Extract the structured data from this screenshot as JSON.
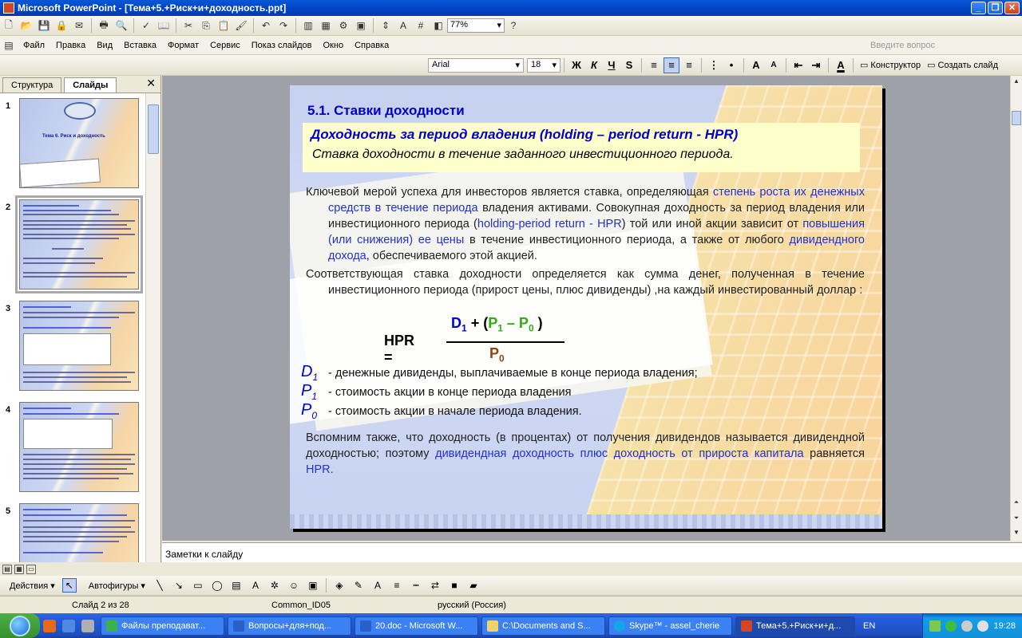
{
  "window": {
    "title": "Microsoft PowerPoint - [Тема+5.+Риск+и+доходность.ppt]"
  },
  "toolbar": {
    "zoom": "77%"
  },
  "menu": {
    "items": [
      "Файл",
      "Правка",
      "Вид",
      "Вставка",
      "Формат",
      "Сервис",
      "Показ слайдов",
      "Окно",
      "Справка"
    ],
    "help_placeholder": "Введите вопрос"
  },
  "format_bar": {
    "font": "Arial",
    "size": "18",
    "bold": "Ж",
    "italic": "К",
    "underline": "Ч",
    "shadow": "S",
    "designer": "Конструктор",
    "new_slide": "Создать слайд"
  },
  "left_panel": {
    "tabs": [
      "Структура",
      "Слайды"
    ],
    "thumbnails": [
      {
        "num": "1",
        "title": "Тема 6. Риск и доходность"
      },
      {
        "num": "2"
      },
      {
        "num": "3"
      },
      {
        "num": "4"
      },
      {
        "num": "5"
      }
    ]
  },
  "slide": {
    "heading": "5.1. Ставки доходности",
    "subtitle1": "Доходность за период владения (holding – period return - HPR)",
    "subtitle2": "Ставка доходности в течение заданного инвестиционного периода.",
    "p1": {
      "a": "Ключевой мерой успеха для инвесторов является ставка, определяющая ",
      "b": "степень роста их денежных средств в течение периода",
      "c": " владения активами. Совокупная доходность за период владения или инвестиционного периода (",
      "d": "holding-period return - HPR",
      "e": ") той или иной акции зависит от ",
      "f": "повышения (или снижения) ее цены",
      "g": " в течение инвестиционного периода, а также от любого ",
      "h": "дивидендного дохода",
      "i": ", обеспечиваемого этой акцией."
    },
    "p2": "Соответствующая ставка доходности определяется как сумма денег, полученная в течение инвестиционного периода (прирост цены, плюс дивиденды) ,на каждый инвестированный доллар :",
    "formula": {
      "label": "HPR  =",
      "d": "D",
      "d_sub": "1",
      "plus": " + (",
      "p1": "P",
      "p1_sub": "1",
      "minus": " – ",
      "p0": "P",
      "p0_sub": "0",
      "close": " )",
      "den": "P",
      "den_sub": "0"
    },
    "defs": [
      {
        "var": "D",
        "sub": "1",
        "text": "- денежные дивиденды, выплачиваемые в конце периода владения;"
      },
      {
        "var": "P",
        "sub": "1",
        "text": "- стоимость акции в конце периода владения"
      },
      {
        "var": "P",
        "sub": "0",
        "text": "-  стоимость акции в начале периода владения."
      }
    ],
    "p3": {
      "a": "Вспомним также, что доходность (в процентах) от получения дивидендов называется дивидендной доходностью; поэтому ",
      "b": "дивидендная доходность плюс доходность от прироста капитала",
      "c": " равняется ",
      "d": "HPR",
      "e": "."
    }
  },
  "notes": {
    "placeholder": "Заметки к слайду"
  },
  "drawbar": {
    "actions": "Действия",
    "autoshapes": "Автофигуры"
  },
  "status": {
    "slide": "Слайд 2 из 28",
    "design": "Common_ID05",
    "lang": "русский (Россия)"
  },
  "taskbar": {
    "items": [
      "Файлы преподават...",
      "Вопросы+для+под...",
      "20.doc - Microsoft W...",
      "C:\\Documents and S...",
      "Skype™ - assel_cherie",
      "Тема+5.+Риск+и+д..."
    ],
    "lang": "EN",
    "time": "19:28"
  }
}
